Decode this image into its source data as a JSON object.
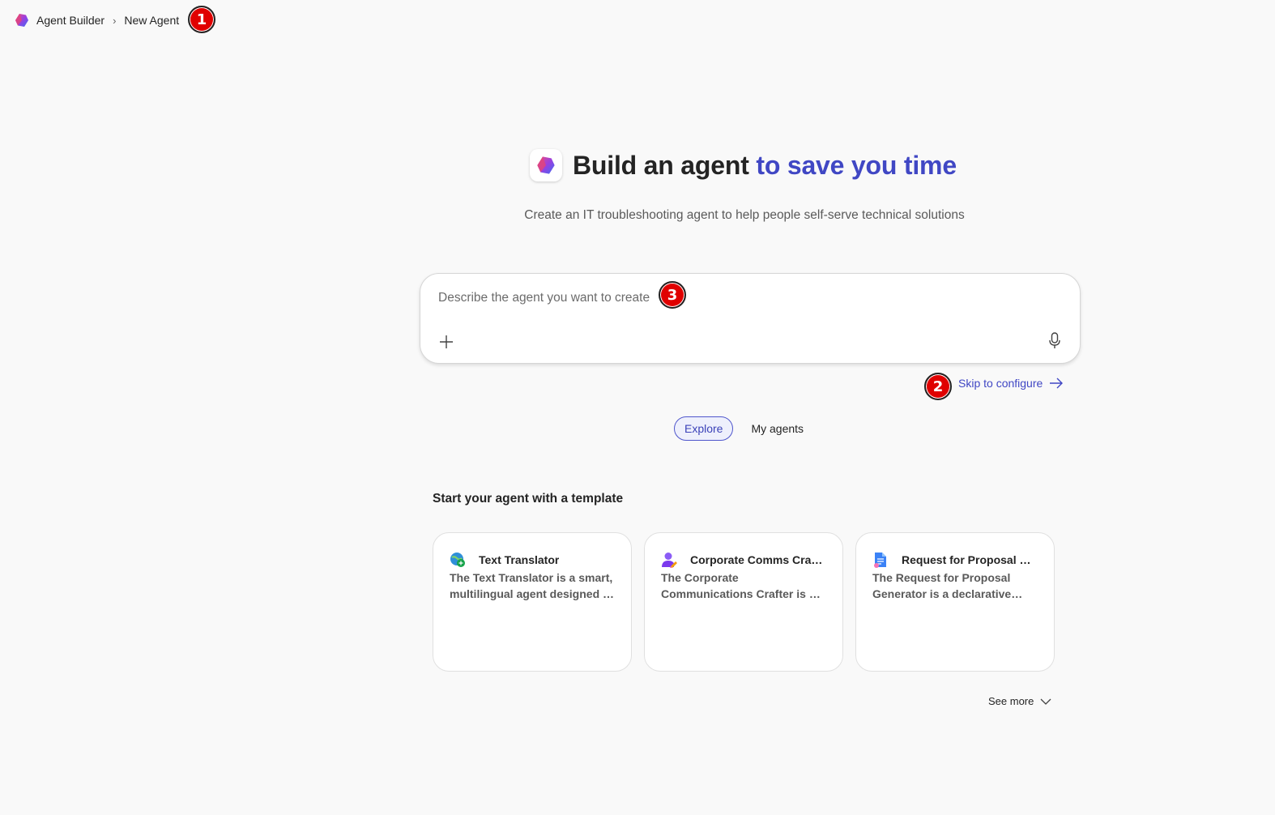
{
  "breadcrumb": {
    "items": [
      "Agent Builder",
      "New Agent"
    ],
    "separator": "›"
  },
  "markers": [
    "1",
    "2",
    "3"
  ],
  "hero": {
    "title_main": "Build an agent",
    "title_accent": "to save you time",
    "subtitle": "Create an IT troubleshooting agent to help people self-serve technical solutions"
  },
  "prompt": {
    "value": "",
    "placeholder": "Describe the agent you want to create",
    "add_icon": "plus-icon",
    "mic_icon": "microphone-icon"
  },
  "skip_link": {
    "label": "Skip to configure",
    "icon": "arrow-right-icon"
  },
  "tabs": [
    {
      "label": "Explore",
      "active": true
    },
    {
      "label": "My agents",
      "active": false
    }
  ],
  "templates": {
    "title": "Start your agent with a template",
    "cards": [
      {
        "title": "Text Translator",
        "description": "The Text Translator is a smart, multilingual agent designed to translate text",
        "icon": "globe-translate-icon"
      },
      {
        "title": "Corporate Comms Crafter",
        "description": "The Corporate Communications Crafter is a declarative agent designed",
        "icon": "person-pen-icon"
      },
      {
        "title": "Request for Proposal Generator",
        "description": "The Request for Proposal Generator is a declarative agent designed",
        "icon": "document-icon"
      }
    ],
    "see_more": "See more"
  },
  "colors": {
    "accent": "#4047c4",
    "background": "#f9f9f9",
    "marker": "#e00000"
  }
}
